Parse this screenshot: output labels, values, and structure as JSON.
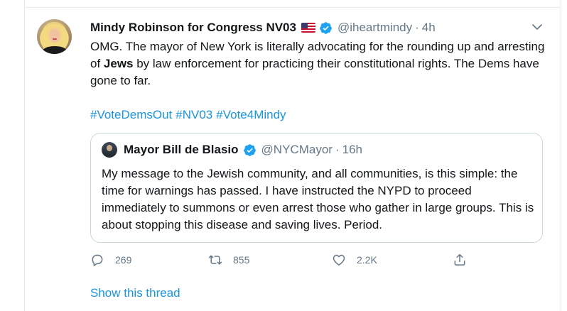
{
  "tweet": {
    "display_name": "Mindy Robinson for Congress NV03",
    "handle": "@iheartmindy",
    "separator": "·",
    "time": "4h",
    "flag_icon": "us-flag-icon",
    "verified_icon": "verified-badge-icon",
    "text_before": "OMG. The mayor of New York is literally advocating for the rounding up and arresting of ",
    "text_bold": "Jews",
    "text_after": " by law enforcement for practicing their constitutional rights. The Dems have gone to far.",
    "hashtags": [
      "#VoteDemsOut",
      "#NV03",
      "#Vote4Mindy"
    ]
  },
  "quote": {
    "display_name": "Mayor Bill de Blasio",
    "handle": "@NYCMayor",
    "separator": "·",
    "time": "16h",
    "text": "My message to the Jewish community, and all communities, is this simple: the time for warnings has passed. I have instructed the NYPD to proceed immediately to summons or even arrest those who gather in large groups. This is about stopping this disease and saving lives. Period."
  },
  "actions": {
    "reply_count": "269",
    "retweet_count": "855",
    "like_count": "2.2K"
  },
  "show_thread_label": "Show this thread",
  "colors": {
    "accent": "#1b95e0",
    "secondary_text": "#657786",
    "border": "#ccd6dd",
    "verified": "#1da1f2"
  }
}
